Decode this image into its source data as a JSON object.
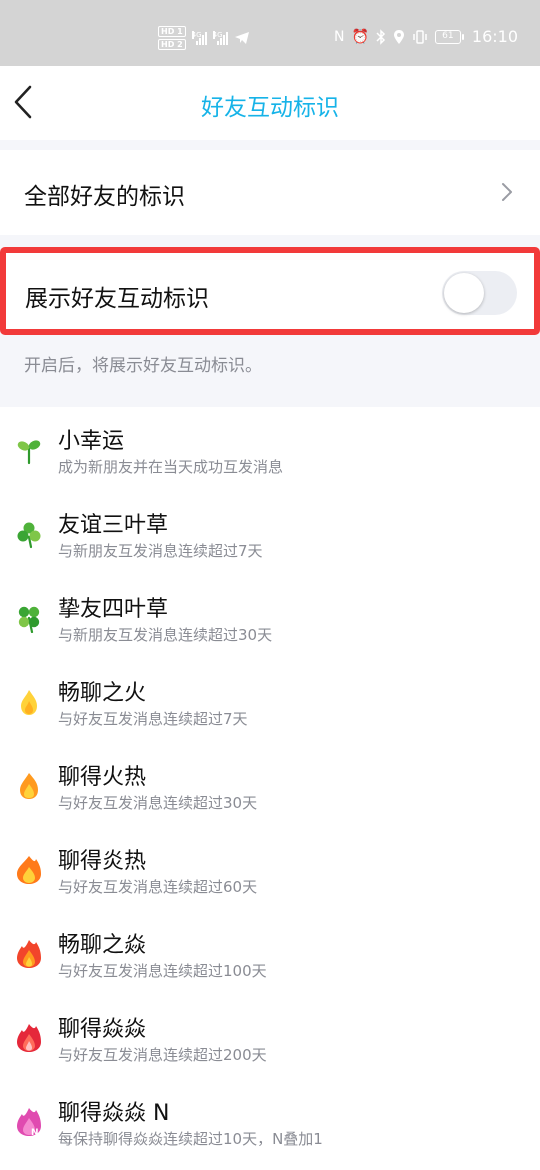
{
  "status_bar": {
    "hd1": "HD 1",
    "hd2": "HD 2",
    "net1": "4G",
    "net2": "4G",
    "battery": "61",
    "time": "16:10"
  },
  "header": {
    "title": "好友互动标识"
  },
  "all_friends_row": {
    "label": "全部好友的标识"
  },
  "toggle_row": {
    "label": "展示好友互动标识",
    "enabled": false
  },
  "hint": "开启后，将展示好友互动标识。",
  "badges": [
    {
      "name": "小幸运",
      "desc": "成为新朋友并在当天成功互发消息",
      "icon": "sprout-icon"
    },
    {
      "name": "友谊三叶草",
      "desc": "与新朋友互发消息连续超过7天",
      "icon": "three-leaf-clover-icon"
    },
    {
      "name": "挚友四叶草",
      "desc": "与新朋友互发消息连续超过30天",
      "icon": "four-leaf-clover-icon"
    },
    {
      "name": "畅聊之火",
      "desc": "与好友互发消息连续超过7天",
      "icon": "small-flame-icon"
    },
    {
      "name": "聊得火热",
      "desc": "与好友互发消息连续超过30天",
      "icon": "flame-icon"
    },
    {
      "name": "聊得炎热",
      "desc": "与好友互发消息连续超过60天",
      "icon": "big-flame-icon"
    },
    {
      "name": "畅聊之焱",
      "desc": "与好友互发消息连续超过100天",
      "icon": "red-flame-icon"
    },
    {
      "name": "聊得焱焱",
      "desc": "与好友互发消息连续超过200天",
      "icon": "crimson-flame-icon"
    },
    {
      "name": "聊得焱焱 N",
      "desc": "每保持聊得焱焱连续超过10天，N叠加1",
      "icon": "pink-flame-icon"
    }
  ],
  "colors": {
    "accent": "#16b3e8",
    "highlight_frame": "#f23a3a",
    "leaf_light": "#7fc648",
    "leaf_dark": "#2f9a2d",
    "flame_yellow": "#ffd23a",
    "flame_orange": "#ff9a1f",
    "flame_red": "#f2452b",
    "flame_pink": "#e04bb0"
  }
}
